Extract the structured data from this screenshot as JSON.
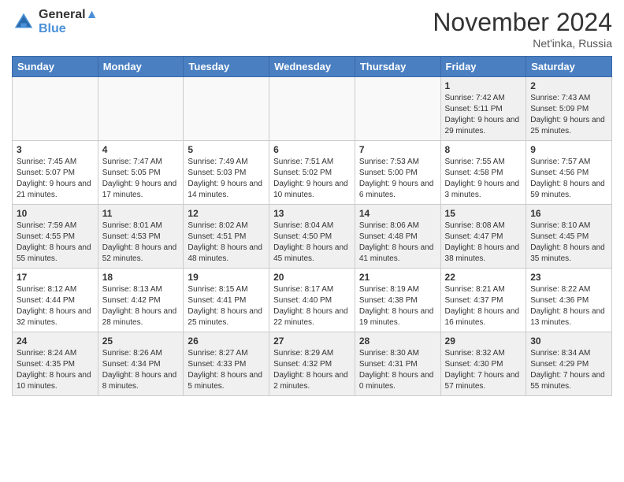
{
  "header": {
    "logo_line1": "General",
    "logo_line2": "Blue",
    "month_title": "November 2024",
    "location": "Net'inka, Russia"
  },
  "days_of_week": [
    "Sunday",
    "Monday",
    "Tuesday",
    "Wednesday",
    "Thursday",
    "Friday",
    "Saturday"
  ],
  "weeks": [
    [
      {
        "day": "",
        "info": "",
        "empty": true
      },
      {
        "day": "",
        "info": "",
        "empty": true
      },
      {
        "day": "",
        "info": "",
        "empty": true
      },
      {
        "day": "",
        "info": "",
        "empty": true
      },
      {
        "day": "",
        "info": "",
        "empty": true
      },
      {
        "day": "1",
        "info": "Sunrise: 7:42 AM\nSunset: 5:11 PM\nDaylight: 9 hours and 29 minutes."
      },
      {
        "day": "2",
        "info": "Sunrise: 7:43 AM\nSunset: 5:09 PM\nDaylight: 9 hours and 25 minutes."
      }
    ],
    [
      {
        "day": "3",
        "info": "Sunrise: 7:45 AM\nSunset: 5:07 PM\nDaylight: 9 hours and 21 minutes."
      },
      {
        "day": "4",
        "info": "Sunrise: 7:47 AM\nSunset: 5:05 PM\nDaylight: 9 hours and 17 minutes."
      },
      {
        "day": "5",
        "info": "Sunrise: 7:49 AM\nSunset: 5:03 PM\nDaylight: 9 hours and 14 minutes."
      },
      {
        "day": "6",
        "info": "Sunrise: 7:51 AM\nSunset: 5:02 PM\nDaylight: 9 hours and 10 minutes."
      },
      {
        "day": "7",
        "info": "Sunrise: 7:53 AM\nSunset: 5:00 PM\nDaylight: 9 hours and 6 minutes."
      },
      {
        "day": "8",
        "info": "Sunrise: 7:55 AM\nSunset: 4:58 PM\nDaylight: 9 hours and 3 minutes."
      },
      {
        "day": "9",
        "info": "Sunrise: 7:57 AM\nSunset: 4:56 PM\nDaylight: 8 hours and 59 minutes."
      }
    ],
    [
      {
        "day": "10",
        "info": "Sunrise: 7:59 AM\nSunset: 4:55 PM\nDaylight: 8 hours and 55 minutes."
      },
      {
        "day": "11",
        "info": "Sunrise: 8:01 AM\nSunset: 4:53 PM\nDaylight: 8 hours and 52 minutes."
      },
      {
        "day": "12",
        "info": "Sunrise: 8:02 AM\nSunset: 4:51 PM\nDaylight: 8 hours and 48 minutes."
      },
      {
        "day": "13",
        "info": "Sunrise: 8:04 AM\nSunset: 4:50 PM\nDaylight: 8 hours and 45 minutes."
      },
      {
        "day": "14",
        "info": "Sunrise: 8:06 AM\nSunset: 4:48 PM\nDaylight: 8 hours and 41 minutes."
      },
      {
        "day": "15",
        "info": "Sunrise: 8:08 AM\nSunset: 4:47 PM\nDaylight: 8 hours and 38 minutes."
      },
      {
        "day": "16",
        "info": "Sunrise: 8:10 AM\nSunset: 4:45 PM\nDaylight: 8 hours and 35 minutes."
      }
    ],
    [
      {
        "day": "17",
        "info": "Sunrise: 8:12 AM\nSunset: 4:44 PM\nDaylight: 8 hours and 32 minutes."
      },
      {
        "day": "18",
        "info": "Sunrise: 8:13 AM\nSunset: 4:42 PM\nDaylight: 8 hours and 28 minutes."
      },
      {
        "day": "19",
        "info": "Sunrise: 8:15 AM\nSunset: 4:41 PM\nDaylight: 8 hours and 25 minutes."
      },
      {
        "day": "20",
        "info": "Sunrise: 8:17 AM\nSunset: 4:40 PM\nDaylight: 8 hours and 22 minutes."
      },
      {
        "day": "21",
        "info": "Sunrise: 8:19 AM\nSunset: 4:38 PM\nDaylight: 8 hours and 19 minutes."
      },
      {
        "day": "22",
        "info": "Sunrise: 8:21 AM\nSunset: 4:37 PM\nDaylight: 8 hours and 16 minutes."
      },
      {
        "day": "23",
        "info": "Sunrise: 8:22 AM\nSunset: 4:36 PM\nDaylight: 8 hours and 13 minutes."
      }
    ],
    [
      {
        "day": "24",
        "info": "Sunrise: 8:24 AM\nSunset: 4:35 PM\nDaylight: 8 hours and 10 minutes."
      },
      {
        "day": "25",
        "info": "Sunrise: 8:26 AM\nSunset: 4:34 PM\nDaylight: 8 hours and 8 minutes."
      },
      {
        "day": "26",
        "info": "Sunrise: 8:27 AM\nSunset: 4:33 PM\nDaylight: 8 hours and 5 minutes."
      },
      {
        "day": "27",
        "info": "Sunrise: 8:29 AM\nSunset: 4:32 PM\nDaylight: 8 hours and 2 minutes."
      },
      {
        "day": "28",
        "info": "Sunrise: 8:30 AM\nSunset: 4:31 PM\nDaylight: 8 hours and 0 minutes."
      },
      {
        "day": "29",
        "info": "Sunrise: 8:32 AM\nSunset: 4:30 PM\nDaylight: 7 hours and 57 minutes."
      },
      {
        "day": "30",
        "info": "Sunrise: 8:34 AM\nSunset: 4:29 PM\nDaylight: 7 hours and 55 minutes."
      }
    ]
  ]
}
